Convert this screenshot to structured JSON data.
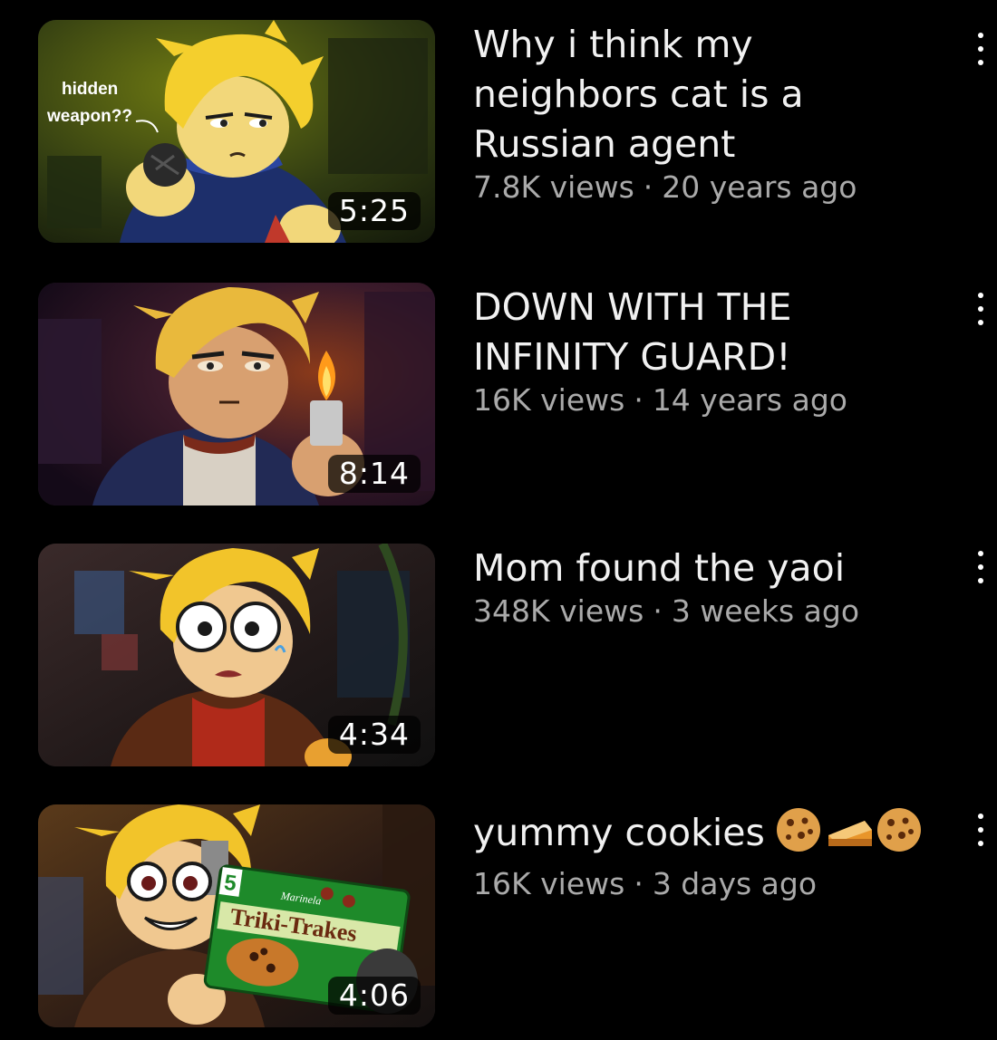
{
  "colors": {
    "background": "#000000",
    "title_text": "#f1f1f1",
    "meta_text": "#aaaaaa",
    "duration_bg": "#000000b8"
  },
  "videos": [
    {
      "title": "Why i think my neighbors cat is a Russian agent",
      "views": "7.8K views",
      "separator": "·",
      "age": "20 years ago",
      "duration": "5:25",
      "thumbnail_caption_line1": "hidden",
      "thumbnail_caption_line2": "weapon??",
      "menu_icon": "more-vert-icon"
    },
    {
      "title": "DOWN WITH THE INFINITY GUARD!",
      "views": "16K views",
      "separator": "·",
      "age": "14 years ago",
      "duration": "8:14",
      "menu_icon": "more-vert-icon"
    },
    {
      "title": "Mom found the yaoi",
      "views": "348K views",
      "separator": "·",
      "age": "3 weeks ago",
      "duration": "4:34",
      "menu_icon": "more-vert-icon"
    },
    {
      "title": "yummy cookies",
      "title_emojis": [
        "cookie-emoji",
        "pie-emoji",
        "cookie-emoji"
      ],
      "views": "16K views",
      "separator": "·",
      "age": "3 days ago",
      "duration": "4:06",
      "thumbnail_brand_text": "Triki-Trakes",
      "thumbnail_brand_small": "Marinela",
      "thumbnail_brand_number": "5",
      "menu_icon": "more-vert-icon"
    }
  ]
}
